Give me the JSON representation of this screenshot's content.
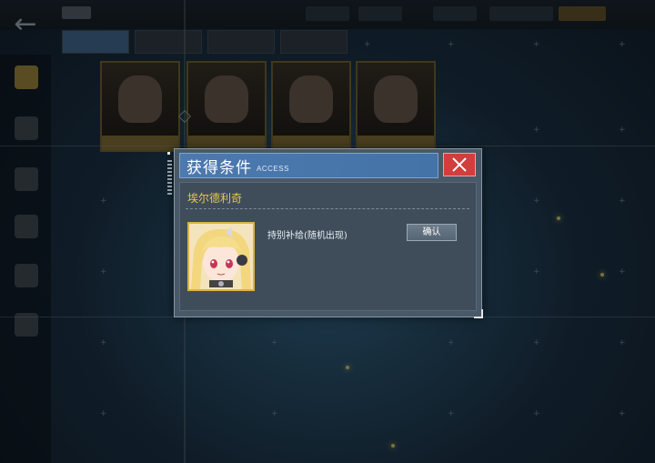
{
  "dialog": {
    "title": "获得条件",
    "subtitle": "ACCESS",
    "close_icon": "close-icon",
    "character_name": "埃尔德利奇",
    "obtain_method": "持别补给(随机出现)",
    "confirm_label": "确认"
  },
  "colors": {
    "header_bg": "#4a76aa",
    "close_bg": "#d23d3d",
    "character_name": "#e6c84a",
    "dialog_bg": "#4a5968",
    "portrait_border": "#d9b442"
  },
  "background": {
    "back_icon": "back-arrow-icon"
  }
}
